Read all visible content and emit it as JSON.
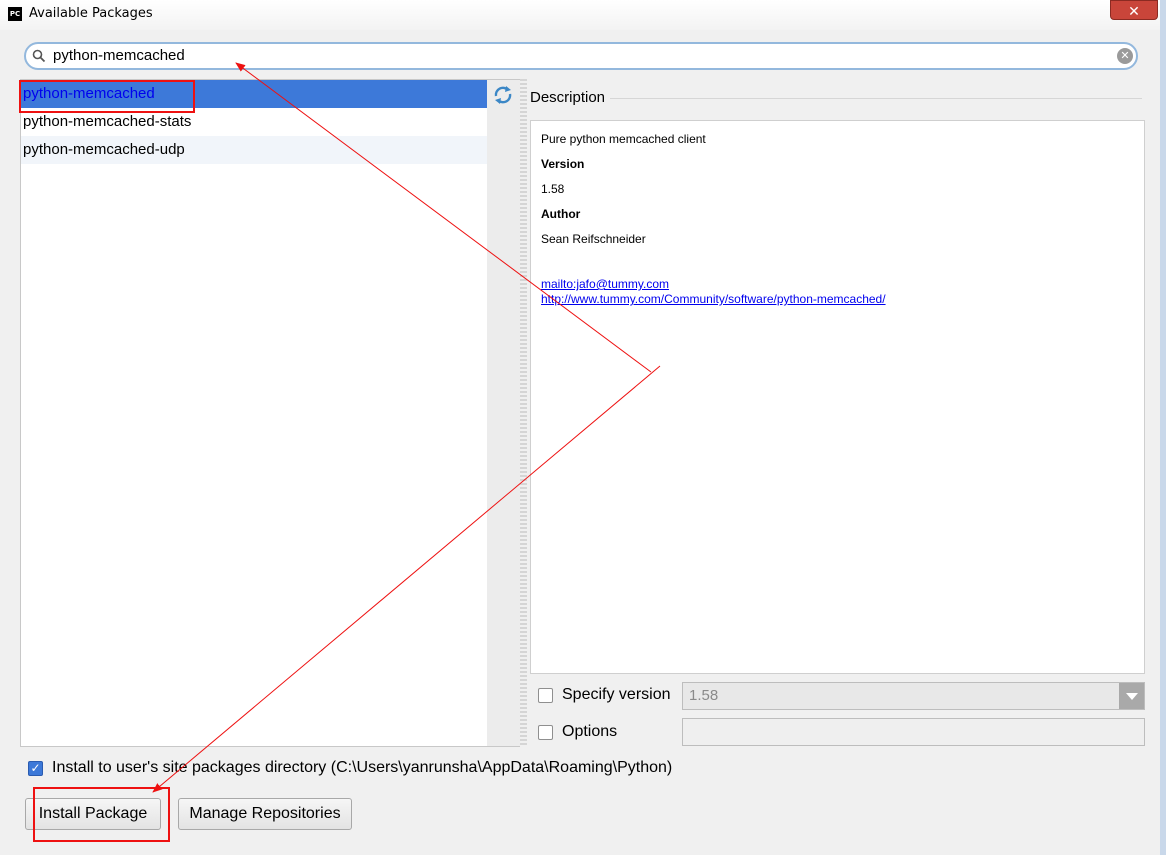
{
  "window": {
    "title": "Available Packages",
    "app_icon_label": "PC",
    "close_label": "✕"
  },
  "search": {
    "value": "python-memcached"
  },
  "packages": [
    {
      "name": "python-memcached",
      "selected": true
    },
    {
      "name": "python-memcached-stats",
      "selected": false
    },
    {
      "name": "python-memcached-udp",
      "selected": false
    }
  ],
  "description": {
    "header": "Description",
    "summary": "Pure python memcached client",
    "version_label": "Version",
    "version_value": "1.58",
    "author_label": "Author",
    "author_value": "Sean Reifschneider",
    "email_link": "mailto:jafo@tummy.com",
    "homepage_link": "http://www.tummy.com/Community/software/python-memcached/"
  },
  "options": {
    "specify_version_label": "Specify version",
    "specify_version_checked": false,
    "version_select_value": "1.58",
    "options_label": "Options",
    "options_checked": false,
    "options_value": "",
    "install_user_label": "Install to user's site packages directory (C:\\Users\\yanrunsha\\AppData\\Roaming\\Python)",
    "install_user_checked": true
  },
  "buttons": {
    "install": "Install Package",
    "manage_repos": "Manage Repositories"
  },
  "colors": {
    "selection": "#3d79d9",
    "annotation": "#ee1111",
    "link": "#0000ee"
  }
}
